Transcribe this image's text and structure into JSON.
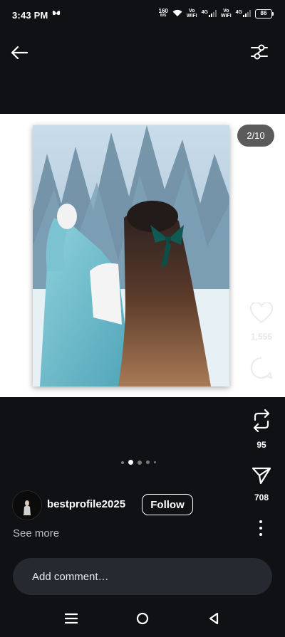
{
  "status_bar": {
    "time": "3:43 PM",
    "net_speed_value": "160",
    "net_speed_unit": "B/S",
    "sim1_top": "Vo",
    "sim1_bottom": "WiFi",
    "sim1_gen": "4G",
    "sim2_top": "Vo",
    "sim2_bottom": "WiFi",
    "sim2_gen": "4G",
    "battery": "86"
  },
  "icons": {
    "status_extra": "butterfly-icon",
    "back": "arrow-left-icon",
    "filter": "sliders-icon",
    "like": "heart-icon",
    "comment": "comment-bubble-icon",
    "repost": "repost-icon",
    "share": "send-icon",
    "more": "more-vertical-icon"
  },
  "post": {
    "image_counter": "2/10",
    "likes": "1,555",
    "reposts": "95",
    "shares": "708",
    "page_index": 2,
    "page_count": 10
  },
  "user": {
    "username": "bestprofile2025",
    "follow_label": "Follow",
    "see_more_label": "See more"
  },
  "comment": {
    "placeholder": "Add comment…"
  },
  "colors": {
    "background": "#0f1114",
    "comment_field": "#262a30",
    "media_background": "#ffffff",
    "counter_badge": "#5b5b5b"
  }
}
